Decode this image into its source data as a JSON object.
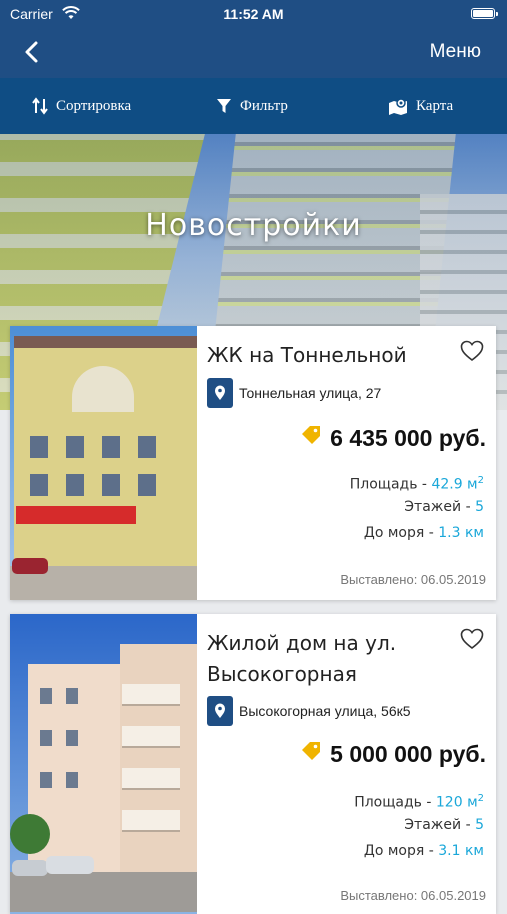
{
  "status_bar": {
    "carrier": "Carrier",
    "time": "11:52 AM"
  },
  "nav": {
    "menu_label": "Меню",
    "back_icon": "chevron-left-icon"
  },
  "toolbar": {
    "sort_label": "Сортировка",
    "filter_label": "Фильтр",
    "map_label": "Карта"
  },
  "hero": {
    "title": "Новостройки"
  },
  "listings": [
    {
      "name": "ЖК на Тоннельной",
      "address": "Тоннельная улица, 27",
      "price": "6 435 000 руб.",
      "area_label": "Площадь",
      "area_value": "42.9 м",
      "area_unit_sup": "2",
      "floors_label": "Этажей",
      "floors_value": "5",
      "sea_label": "До моря",
      "sea_value": "1.3 км",
      "posted": "Выставлено: 06.05.2019"
    },
    {
      "name": "Жилой дом на ул. Высокогорная",
      "address": "Высокогорная улица, 56к5",
      "price": "5 000 000 руб.",
      "area_label": "Площадь",
      "area_value": "120 м",
      "area_unit_sup": "2",
      "floors_label": "Этажей",
      "floors_value": "5",
      "sea_label": "До моря",
      "sea_value": "3.1 км",
      "posted": "Выставлено: 06.05.2019"
    }
  ],
  "colors": {
    "primary": "#1f4e84",
    "toolbar": "#0f4d84",
    "accent": "#1aa7d9",
    "price_tag": "#f0b400"
  }
}
